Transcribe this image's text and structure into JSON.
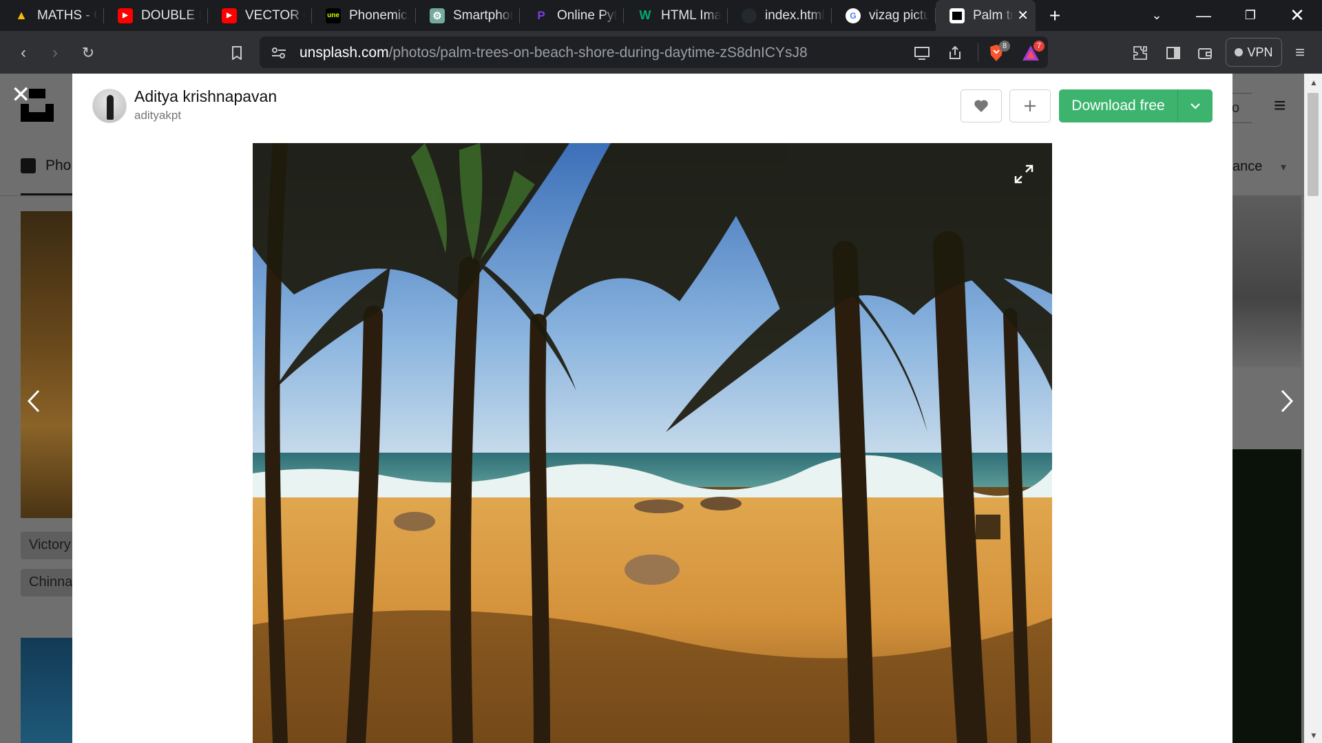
{
  "browser": {
    "tabs": [
      {
        "title": "MATHS - Go",
        "icon": "google-drive-icon",
        "color": "#34a853"
      },
      {
        "title": "DOUBLE INT",
        "icon": "youtube-icon",
        "color": "#ff0000"
      },
      {
        "title": "VECTOR CAL",
        "icon": "youtube-icon",
        "color": "#ff0000"
      },
      {
        "title": "Phonemic tr",
        "icon": "une-icon",
        "color": "#000000"
      },
      {
        "title": "Smartphone",
        "icon": "chatgpt-icon",
        "color": "#74aa9c"
      },
      {
        "title": "Online Pytho",
        "icon": "online-python-icon",
        "color": "#6c2bd9"
      },
      {
        "title": "HTML Image",
        "icon": "w3-icon",
        "color": "#04aa6d"
      },
      {
        "title": "index.html -",
        "icon": "github-icon",
        "color": "#24292e"
      },
      {
        "title": "vizag pictur",
        "icon": "google-icon",
        "color": "#ffffff"
      },
      {
        "title": "Palm tre",
        "icon": "unsplash-icon",
        "color": "#000000",
        "active": true
      }
    ],
    "url_host": "unsplash.com",
    "url_path": "/photos/palm-trees-on-beach-shore-during-daytime-zS8dnICYsJ8",
    "brave_shield_count": "8",
    "rewards_count": "7",
    "vpn_label": "VPN"
  },
  "background": {
    "nav_tab_label": "Pho",
    "chips": [
      "Victory",
      "Chinna"
    ],
    "relevance_label": "ance",
    "right_button_label": "o"
  },
  "modal": {
    "author_name": "Aditya krishnapavan",
    "author_handle": "adityakpt",
    "download_label": "Download free",
    "photo_alt": "palm trees on beach shore during daytime"
  },
  "colors": {
    "download_green": "#3cb46e",
    "tab_strip": "#1b1c1f",
    "toolbar": "#303134"
  }
}
